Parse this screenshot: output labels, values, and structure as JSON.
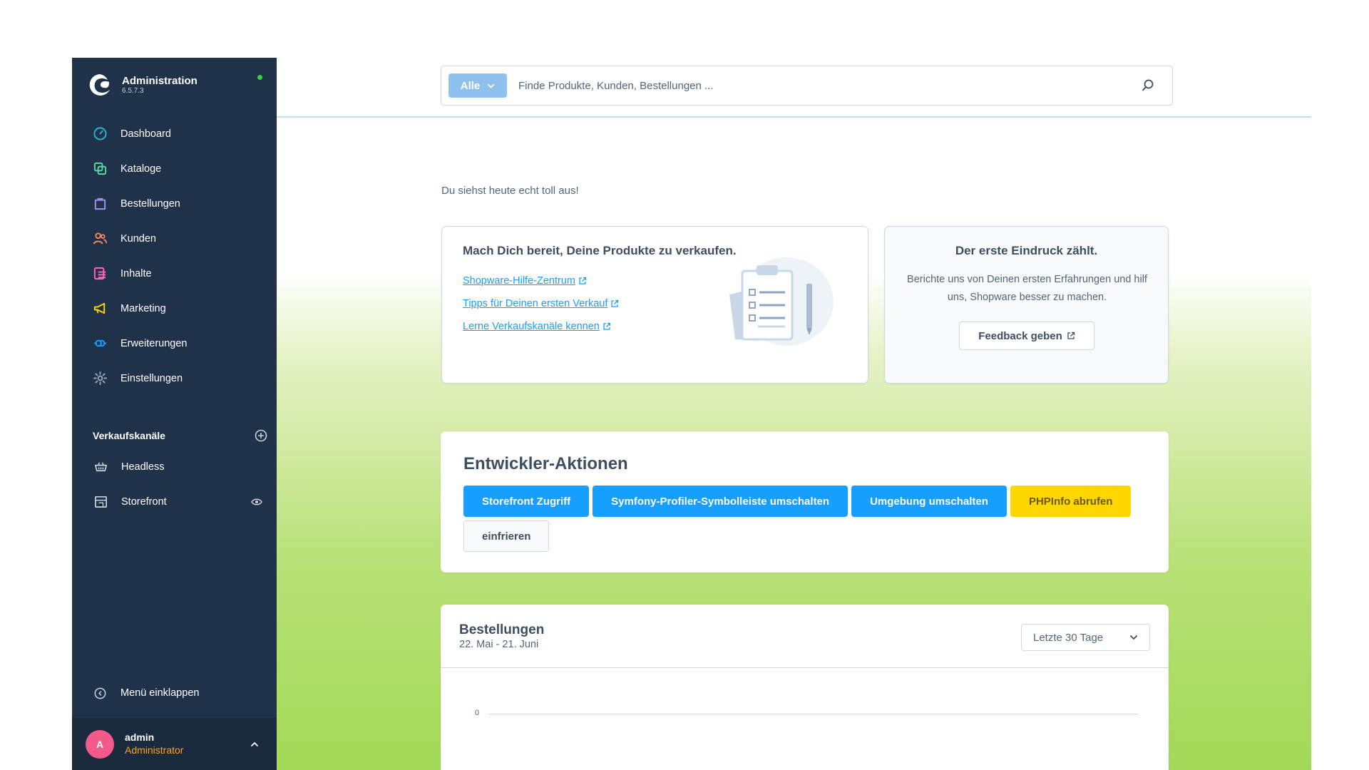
{
  "brand": {
    "title": "Administration",
    "version": "6.5.7.3"
  },
  "nav": [
    {
      "label": "Dashboard",
      "icon": "dashboard-icon",
      "color": "#26b6cf"
    },
    {
      "label": "Kataloge",
      "icon": "catalog-icon",
      "color": "#57d9a3"
    },
    {
      "label": "Bestellungen",
      "icon": "orders-icon",
      "color": "#a092f0"
    },
    {
      "label": "Kunden",
      "icon": "customers-icon",
      "color": "#f88962"
    },
    {
      "label": "Inhalte",
      "icon": "content-icon",
      "color": "#ff68b4"
    },
    {
      "label": "Marketing",
      "icon": "marketing-icon",
      "color": "#ffd700"
    },
    {
      "label": "Erweiterungen",
      "icon": "extensions-icon",
      "color": "#189eff"
    },
    {
      "label": "Einstellungen",
      "icon": "settings-icon",
      "color": "#9aa8b5"
    }
  ],
  "sales_channels": {
    "title": "Verkaufskanäle",
    "items": [
      {
        "label": "Headless"
      },
      {
        "label": "Storefront"
      }
    ]
  },
  "sidebar_footer": {
    "collapse_label": "Menü einklappen"
  },
  "user": {
    "initial": "A",
    "name": "admin",
    "role": "Administrator"
  },
  "search": {
    "type_label": "Alle",
    "placeholder": "Finde Produkte, Kunden, Bestellungen ..."
  },
  "greeting": "Du siehst heute echt toll aus!",
  "sell_card": {
    "title": "Mach Dich bereit, Deine Produkte zu verkaufen.",
    "links": [
      "Shopware-Hilfe-Zentrum",
      "Tipps für Deinen ersten Verkauf",
      "Lerne Verkaufskanäle kennen"
    ]
  },
  "feedback_card": {
    "title": "Der erste Eindruck zählt.",
    "text": "Berichte uns von Deinen ersten Erfahrungen und hilf uns, Shopware besser zu machen.",
    "button": "Feedback geben"
  },
  "dev_actions": {
    "title": "Entwickler-Aktionen",
    "buttons": [
      "Storefront Zugriff",
      "Symfony-Profiler-Symbolleiste umschalten",
      "Umgebung umschalten",
      "PHPInfo abrufen",
      "einfrieren"
    ]
  },
  "orders": {
    "title": "Bestellungen",
    "range": "22. Mai - 21. Juni",
    "select_value": "Letzte 30 Tage",
    "axis_zero": "0"
  },
  "colors": {
    "sidebar": "#203249",
    "accent": "#189eff",
    "warning": "#ffd700",
    "status_online": "#37d046"
  }
}
